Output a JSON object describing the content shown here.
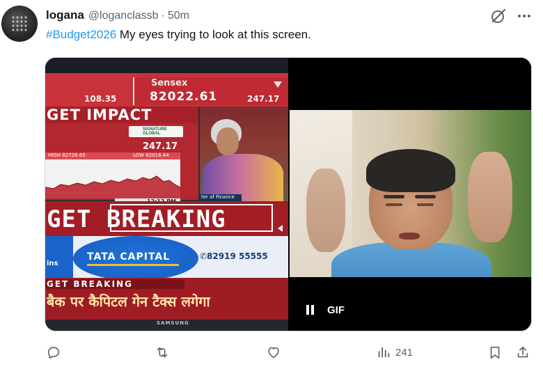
{
  "post": {
    "display_name": "logana",
    "handle": "@loganclassb",
    "separator": "·",
    "time": "50m",
    "hashtag": "#Budget2026",
    "text": " My eyes trying to look at this screen."
  },
  "tv": {
    "ticker_left_value": "108.35",
    "sensex_label": "Sensex",
    "sensex_value": "82022.61",
    "sensex_change": "247.17",
    "impact_text": "GET IMPACT",
    "chart_value": "247.17",
    "high_label": "HIGH 82726.65",
    "low_label": "LOW 82016.44",
    "chart_time": "12:12 PM",
    "fm_caption": "ter of Finance",
    "breaking_text": "GET BREAKING",
    "ad_left_text": "ins",
    "tata_text": "TATA CAPITAL",
    "phone_text": "✆82919 55555",
    "bottom_label": "GET BREAKING",
    "hindi_line": "बैक पर कैपिटल गेन टैक्स लगेगा",
    "brand": "SAMSUNG"
  },
  "gif": {
    "label": "GIF"
  },
  "actions": {
    "views": "241"
  },
  "colors": {
    "accent": "#1d9bf0",
    "muted": "#536471",
    "text": "#0f1419"
  },
  "icons": [
    "grok-icon",
    "more-icon",
    "reply-icon",
    "repost-icon",
    "like-icon",
    "views-icon",
    "bookmark-icon",
    "share-icon",
    "pause-icon"
  ]
}
